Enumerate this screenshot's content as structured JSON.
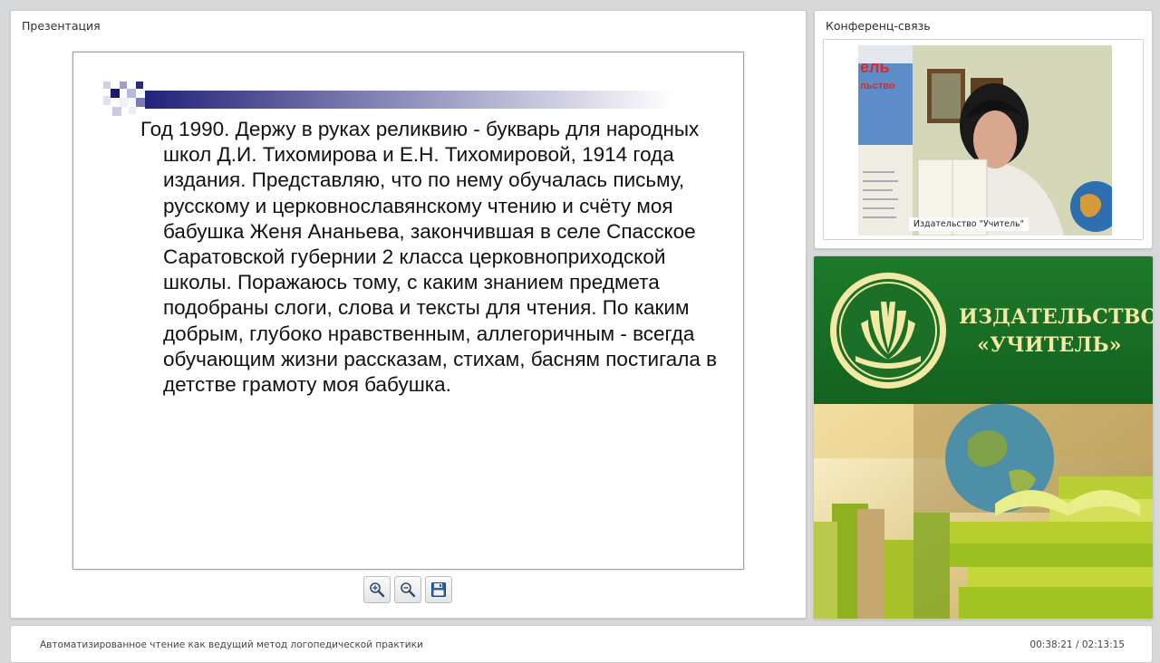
{
  "presentation": {
    "title": "Презентация",
    "slide_text": "Год 1990. Держу в руках реликвию - букварь для народных школ Д.И. Тихомирова и Е.Н. Тихомировой, 1914 года издания. Представляю, что по нему обучалась письму, русскому и церковнославянскому чтению и счёту моя бабушка Женя Ананьева, закончившая в селе Спасское Саратовской губернии 2 класса церковноприходской школы. Поражаюсь тому, с каким знанием предмета подобраны слоги, слова и тексты для чтения. По каким добрым, глубоко нравственным, аллегоричным - всегда обучающим жизни рассказам, стихам, басням постигала в детстве грамоту моя бабушка.",
    "toolbar": {
      "zoom_in_icon": "zoom-in-icon",
      "zoom_out_icon": "zoom-out-icon",
      "save_icon": "floppy-disk-icon"
    }
  },
  "conference": {
    "title": "Конференц-связь",
    "participant_caption": "Издательство \"Учитель\""
  },
  "brand": {
    "name_line1": "ИЗДАТЕЛЬСТВО",
    "name_line2": "«УЧИТЕЛЬ»",
    "colors": {
      "green": "#1a7326",
      "cream": "#f3e9a4"
    }
  },
  "footer": {
    "lecture_title": "Автоматизированное чтение как ведущий метод логопедической практики",
    "elapsed": "00:38:21",
    "total": "02:13:15"
  }
}
